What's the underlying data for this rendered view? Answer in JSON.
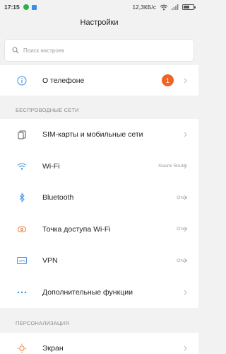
{
  "status_bar": {
    "time": "17:15",
    "speed": "12,3КБ/с"
  },
  "page": {
    "title": "Настройки"
  },
  "search": {
    "placeholder": "Поиск настроек",
    "icon": "search-icon"
  },
  "about": {
    "label": "О телефоне",
    "badge": "1",
    "icon": "info-icon"
  },
  "wireless": {
    "header": "БЕСПРОВОДНЫЕ СЕТИ",
    "items": [
      {
        "label": "SIM-карты и мобильные сети",
        "value": "",
        "icon": "sim-card-icon"
      },
      {
        "label": "Wi-Fi",
        "value": "Xiaomi Router",
        "icon": "wifi-icon"
      },
      {
        "label": "Bluetooth",
        "value": "Откл",
        "icon": "bluetooth-icon"
      },
      {
        "label": "Точка доступа Wi-Fi",
        "value": "Откл",
        "icon": "hotspot-icon"
      },
      {
        "label": "VPN",
        "value": "Откл",
        "icon": "vpn-icon"
      },
      {
        "label": "Дополнительные функции",
        "value": "",
        "icon": "more-icon"
      }
    ]
  },
  "personalization": {
    "header": "ПЕРСОНАЛИЗАЦИЯ",
    "items": [
      {
        "label": "Экран",
        "value": "",
        "icon": "display-icon"
      }
    ]
  },
  "colors": {
    "accent_blue": "#3a8ee6",
    "badge_orange": "#f06423",
    "display_orange": "#f07a3c",
    "background": "#f2f2f2"
  }
}
